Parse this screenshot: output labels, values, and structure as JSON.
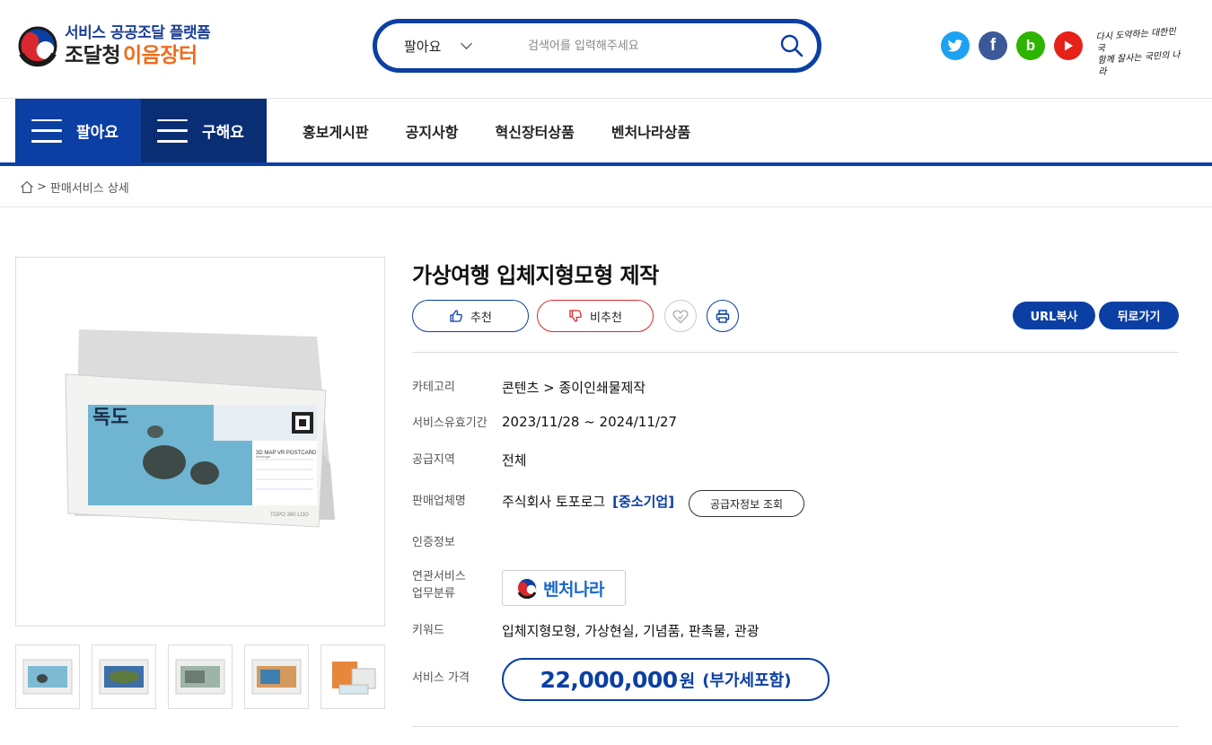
{
  "header": {
    "logo_line1": "서비스 공공조달 플랫폼",
    "logo_org": "조달청",
    "logo_brand": "이음장터",
    "search": {
      "selected_option": "팔아요",
      "placeholder": "검색어를 입력해주세요"
    },
    "socials": [
      {
        "icon": "twitter-icon",
        "label": "twitter",
        "color": "#1da1f2"
      },
      {
        "icon": "facebook-icon",
        "label": "f",
        "color": "#3b5998"
      },
      {
        "icon": "blog-icon",
        "label": "b",
        "color": "#2db400"
      },
      {
        "icon": "youtube-icon",
        "label": "youtube",
        "color": "#e62117"
      }
    ],
    "slogan_line1": "다시 도약하는 대한민국",
    "slogan_line2": "함께 잘사는 국민의 나라"
  },
  "nav": {
    "sell_label": "팔아요",
    "buy_label": "구해요",
    "links": [
      "홍보게시판",
      "공지사항",
      "혁신장터상품",
      "벤처나라상품"
    ]
  },
  "breadcrumb": {
    "separator": ">",
    "current": "판매서비스 상세"
  },
  "product": {
    "title": "가상여행 입체지형모형 제작",
    "recommend_label": "추천",
    "not_recommend_label": "비추천",
    "url_copy_label": "URL복사",
    "back_label": "뒤로가기",
    "image_caption": {
      "name": "독도",
      "card_title": "3D MAP VR POSTCARD",
      "card_sub": "Message",
      "brand": "TOPO 360 LOG"
    },
    "fields": {
      "category_label": "카테고리",
      "category_value": "콘텐츠 > 종이인쇄물제작",
      "validity_label": "서비스유효기간",
      "validity_value": "2023/11/28 ~ 2024/11/27",
      "region_label": "공급지역",
      "region_value": "전체",
      "seller_label": "판매업체명",
      "seller_value": "주식회사 토포로그",
      "seller_badge": "[중소기업]",
      "supplier_info_label": "공급자정보 조회",
      "certification_label": "인증정보",
      "related_label_line1": "연관서비스",
      "related_label_line2": "업무분류",
      "related_value": "벤처나라",
      "keyword_label": "키워드",
      "keyword_value": "입체지형모형, 가상현실, 기념품, 판촉물, 관광",
      "price_label": "서비스 가격",
      "price_amount": "22,000,000",
      "price_unit": "원",
      "price_vat": "(부가세포함)"
    }
  },
  "colors": {
    "primary": "#0b3fa3",
    "primary_dark": "#0a2e73",
    "brand_orange": "#ef6c1a",
    "dislike_red": "#d9292f"
  }
}
